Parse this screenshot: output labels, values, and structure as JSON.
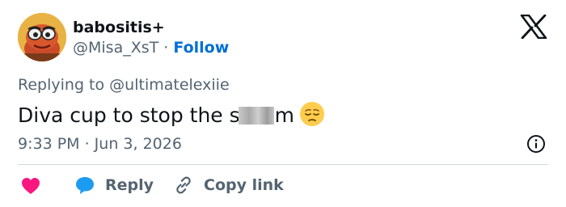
{
  "author": {
    "display_name": "babositis+",
    "handle": "@Misa_XsT",
    "separator": "·",
    "follow_label": "Follow",
    "avatar": "cartoon-character-avatar"
  },
  "reply_context": {
    "prefix": "Replying to",
    "handle": "@ultimatelexiie"
  },
  "tweet": {
    "text_before": "Diva cup to stop the s",
    "text_after": "m",
    "redacted": true,
    "emoji": "pensive-face-emoji",
    "timestamp": "9:33 PM · Jun 3, 2026"
  },
  "actions": {
    "like_icon": "heart-icon",
    "reply_label": "Reply",
    "copy_link_label": "Copy link"
  },
  "branding": {
    "logo": "x-logo"
  },
  "colors": {
    "text": "#0f1419",
    "muted": "#536471",
    "link": "#006fd6",
    "heart": "#f91880",
    "reply_bubble": "#1d9bf0",
    "divider": "#cfd9de"
  }
}
